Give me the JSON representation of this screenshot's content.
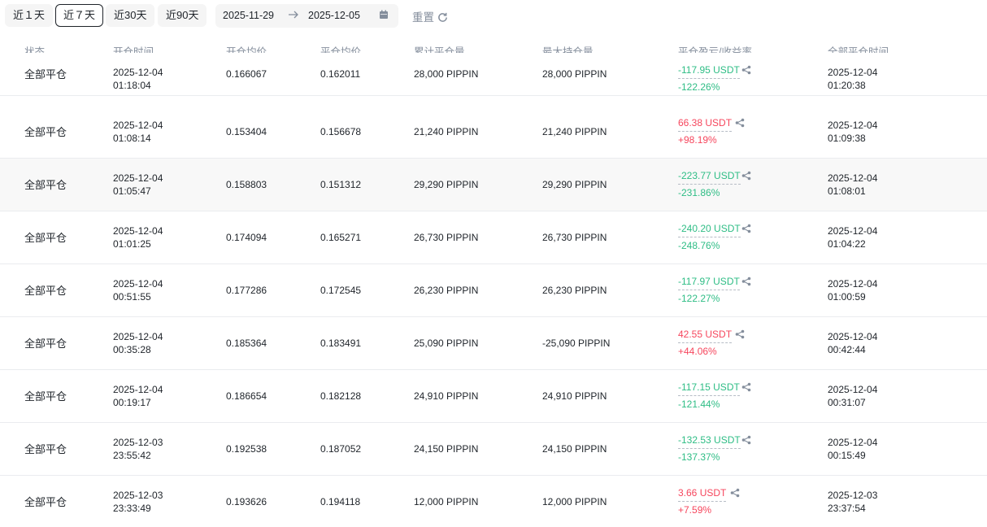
{
  "filters": {
    "ranges": [
      "近１天",
      "近７天",
      "近30天",
      "近90天"
    ],
    "active": "近７天",
    "date_from": "2025-11-29",
    "date_to": "2025-12-05",
    "reset_label": "重置"
  },
  "columns": [
    "状态",
    "开仓时间",
    "开仓均价",
    "平仓均价",
    "累计平仓量",
    "最大持仓量",
    "平仓盈亏/收益率",
    "全部平仓时间"
  ],
  "pnl_header": {
    "a": "平仓盈亏",
    "sep": "/",
    "b": "收益率"
  },
  "rows": [
    {
      "status": "全部平仓",
      "open_date": "2025-12-04",
      "open_time": "01:18:04",
      "open_price": "0.166067",
      "close_price": "0.162011",
      "cum_qty": "28,000 PIPPIN",
      "max_qty": "28,000 PIPPIN",
      "pnl": "-117.95 USDT",
      "roi": "-122.26%",
      "dir": "loss",
      "close_date": "2025-12-04",
      "close_time": "01:20:38"
    },
    {
      "status": "全部平仓",
      "open_date": "2025-12-04",
      "open_time": "01:08:14",
      "open_price": "0.153404",
      "close_price": "0.156678",
      "cum_qty": "21,240 PIPPIN",
      "max_qty": "21,240 PIPPIN",
      "pnl": "66.38 USDT",
      "roi": "+98.19%",
      "dir": "gain",
      "close_date": "2025-12-04",
      "close_time": "01:09:38"
    },
    {
      "status": "全部平仓",
      "open_date": "2025-12-04",
      "open_time": "01:05:47",
      "open_price": "0.158803",
      "close_price": "0.151312",
      "cum_qty": "29,290 PIPPIN",
      "max_qty": "29,290 PIPPIN",
      "pnl": "-223.77 USDT",
      "roi": "-231.86%",
      "dir": "loss",
      "close_date": "2025-12-04",
      "close_time": "01:08:01"
    },
    {
      "status": "全部平仓",
      "open_date": "2025-12-04",
      "open_time": "01:01:25",
      "open_price": "0.174094",
      "close_price": "0.165271",
      "cum_qty": "26,730 PIPPIN",
      "max_qty": "26,730 PIPPIN",
      "pnl": "-240.20 USDT",
      "roi": "-248.76%",
      "dir": "loss",
      "close_date": "2025-12-04",
      "close_time": "01:04:22"
    },
    {
      "status": "全部平仓",
      "open_date": "2025-12-04",
      "open_time": "00:51:55",
      "open_price": "0.177286",
      "close_price": "0.172545",
      "cum_qty": "26,230 PIPPIN",
      "max_qty": "26,230 PIPPIN",
      "pnl": "-117.97 USDT",
      "roi": "-122.27%",
      "dir": "loss",
      "close_date": "2025-12-04",
      "close_time": "01:00:59"
    },
    {
      "status": "全部平仓",
      "open_date": "2025-12-04",
      "open_time": "00:35:28",
      "open_price": "0.185364",
      "close_price": "0.183491",
      "cum_qty": "25,090 PIPPIN",
      "max_qty": "-25,090 PIPPIN",
      "pnl": "42.55 USDT",
      "roi": "+44.06%",
      "dir": "gain",
      "close_date": "2025-12-04",
      "close_time": "00:42:44"
    },
    {
      "status": "全部平仓",
      "open_date": "2025-12-04",
      "open_time": "00:19:17",
      "open_price": "0.186654",
      "close_price": "0.182128",
      "cum_qty": "24,910 PIPPIN",
      "max_qty": "24,910 PIPPIN",
      "pnl": "-117.15 USDT",
      "roi": "-121.44%",
      "dir": "loss",
      "close_date": "2025-12-04",
      "close_time": "00:31:07"
    },
    {
      "status": "全部平仓",
      "open_date": "2025-12-03",
      "open_time": "23:55:42",
      "open_price": "0.192538",
      "close_price": "0.187052",
      "cum_qty": "24,150 PIPPIN",
      "max_qty": "24,150 PIPPIN",
      "pnl": "-132.53 USDT",
      "roi": "-137.37%",
      "dir": "loss",
      "close_date": "2025-12-04",
      "close_time": "00:15:49"
    },
    {
      "status": "全部平仓",
      "open_date": "2025-12-03",
      "open_time": "23:33:49",
      "open_price": "0.193626",
      "close_price": "0.194118",
      "cum_qty": "12,000 PIPPIN",
      "max_qty": "12,000 PIPPIN",
      "pnl": "3.66 USDT",
      "roi": "+7.59%",
      "dir": "gain",
      "close_date": "2025-12-03",
      "close_time": "23:37:54"
    }
  ]
}
